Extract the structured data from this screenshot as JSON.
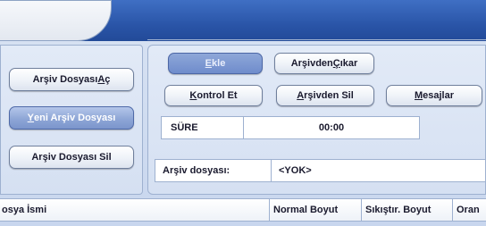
{
  "left_buttons": {
    "open_archive": {
      "pre": "Arşiv Dosyası ",
      "accel": "A",
      "post": "ç"
    },
    "new_archive": {
      "pre": "",
      "accel": "Y",
      "post": "eni Arşiv Dosyası"
    },
    "delete_archive": {
      "label": "Arşiv Dosyası Sil"
    }
  },
  "action_buttons": {
    "add": {
      "pre": "",
      "accel": "E",
      "post": "kle"
    },
    "extract": {
      "pre": "Arşivden ",
      "accel": "Ç",
      "post": "ıkar"
    },
    "check": {
      "pre": "",
      "accel": "K",
      "post": "ontrol Et"
    },
    "remove": {
      "pre": "",
      "accel": "A",
      "post": "rşivden Sil"
    },
    "messages": {
      "pre": "",
      "accel": "M",
      "post": "esajlar"
    }
  },
  "duration": {
    "label": "SÜRE",
    "value": "00:00"
  },
  "archive_file": {
    "label": "Arşiv dosyası:",
    "value": "<YOK>"
  },
  "file_list": {
    "columns": [
      "osya İsmi",
      "Normal Boyut",
      "Sıkıştır. Boyut",
      "Oran"
    ]
  }
}
